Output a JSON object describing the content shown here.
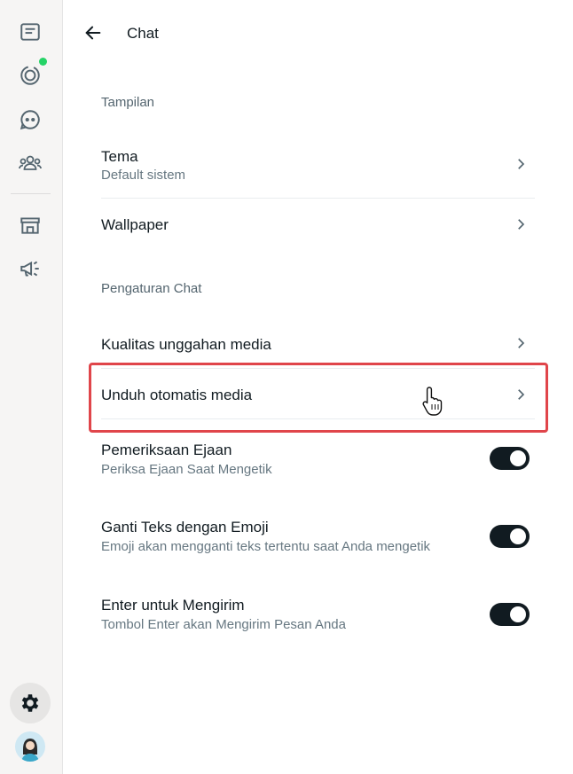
{
  "header": {
    "title": "Chat"
  },
  "sections": {
    "tampilan": "Tampilan",
    "pengaturan_chat": "Pengaturan Chat"
  },
  "rows": {
    "tema": {
      "title": "Tema",
      "subtitle": "Default sistem"
    },
    "wallpaper": {
      "title": "Wallpaper"
    },
    "kualitas": {
      "title": "Kualitas unggahan media"
    },
    "unduh": {
      "title": "Unduh otomatis media"
    },
    "ejaan": {
      "title": "Pemeriksaan Ejaan",
      "subtitle": "Periksa Ejaan Saat Mengetik",
      "enabled": true
    },
    "emoji": {
      "title": "Ganti Teks dengan Emoji",
      "subtitle": "Emoji akan mengganti teks tertentu saat Anda mengetik",
      "enabled": true
    },
    "enter": {
      "title": "Enter untuk Mengirim",
      "subtitle": "Tombol Enter akan Mengirim Pesan Anda",
      "enabled": true
    }
  },
  "sidebar": {
    "items": [
      {
        "icon": "chats-icon"
      },
      {
        "icon": "status-icon",
        "unread_dot": true
      },
      {
        "icon": "channels-icon"
      },
      {
        "icon": "communities-icon"
      },
      {
        "icon": "business-tools-icon"
      },
      {
        "icon": "advertise-icon"
      },
      {
        "icon": "settings-icon",
        "active": true
      },
      {
        "icon": "profile-avatar"
      }
    ]
  },
  "colors": {
    "highlight_border": "#e0454a",
    "toggle_on": "#111b21",
    "status_dot": "#25d366"
  }
}
